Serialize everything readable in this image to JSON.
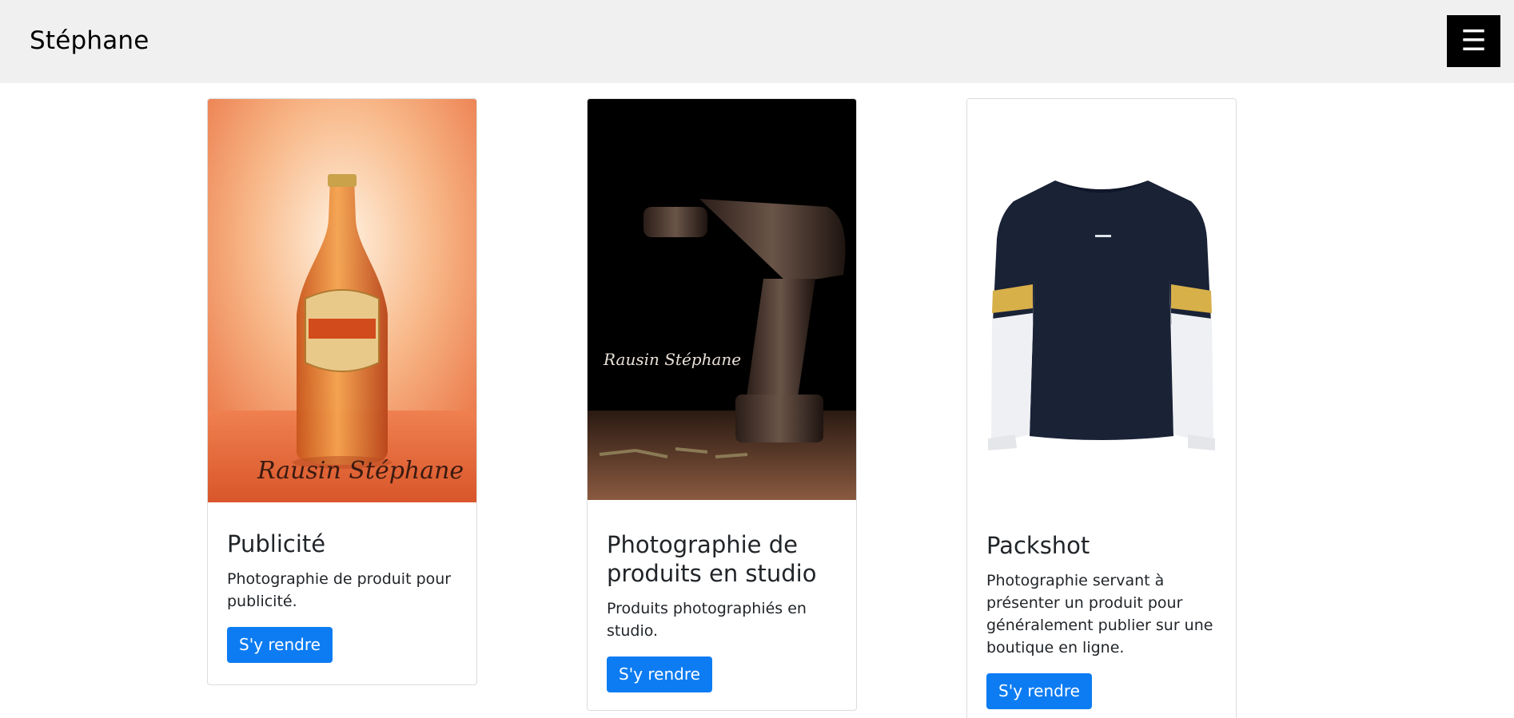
{
  "navbar": {
    "brand": "Stéphane",
    "menu_icon": "hamburger-menu-icon",
    "menu_glyph": "☰"
  },
  "cards": [
    {
      "image": "orange-bottle-photo",
      "image_signature": "Rausin Stéphane",
      "title": "Publicité",
      "text": "Photographie de produit pour publicité.",
      "button": "S'y rendre"
    },
    {
      "image": "power-drill-photo",
      "image_signature": "Rausin Stéphane",
      "title": "Photographie de produits en studio",
      "text": "Produits photographiés en studio.",
      "button": "S'y rendre"
    },
    {
      "image": "navy-sweater-photo",
      "title": "Packshot",
      "text": "Photographie servant à présenter un produit pour généralement publier sur une boutique en ligne.",
      "button": "S'y rendre"
    }
  ],
  "colors": {
    "navbar_bg": "#f0f0f0",
    "button_bg": "#0d7cf2",
    "toggler_bg": "#000000"
  }
}
